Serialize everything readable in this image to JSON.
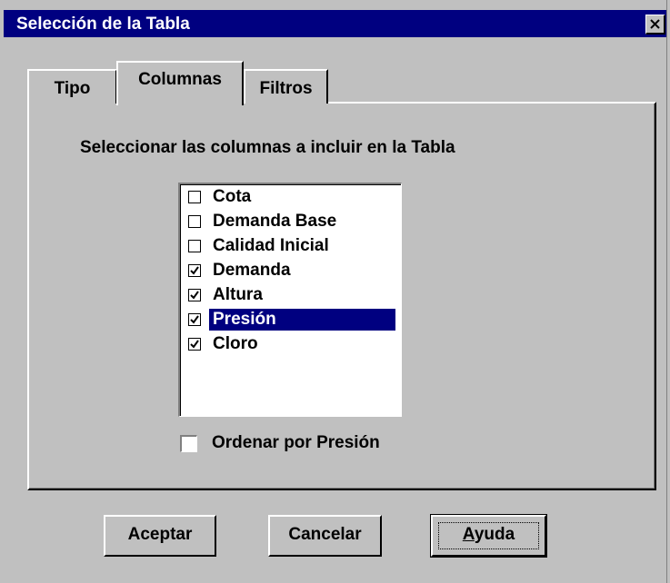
{
  "window": {
    "title": "Selección de la Tabla"
  },
  "tabs": [
    {
      "label": "Tipo",
      "active": false
    },
    {
      "label": "Columnas",
      "active": true
    },
    {
      "label": "Filtros",
      "active": false
    }
  ],
  "columns_tab": {
    "instructions": "Seleccionar las columnas a incluir en la Tabla",
    "items": [
      {
        "label": "Cota",
        "checked": false,
        "selected": false
      },
      {
        "label": "Demanda Base",
        "checked": false,
        "selected": false
      },
      {
        "label": "Calidad Inicial",
        "checked": false,
        "selected": false
      },
      {
        "label": "Demanda",
        "checked": true,
        "selected": false
      },
      {
        "label": "Altura",
        "checked": true,
        "selected": false
      },
      {
        "label": "Presión",
        "checked": true,
        "selected": true
      },
      {
        "label": "Cloro",
        "checked": true,
        "selected": false
      }
    ],
    "sort_option": {
      "label": "Ordenar por Presión",
      "checked": false
    }
  },
  "buttons": {
    "ok": "Aceptar",
    "cancel": "Cancelar",
    "help_first": "A",
    "help_rest": "yuda"
  },
  "colors": {
    "titlebar": "#000080",
    "face": "#c0c0c0",
    "selection": "#000080"
  }
}
